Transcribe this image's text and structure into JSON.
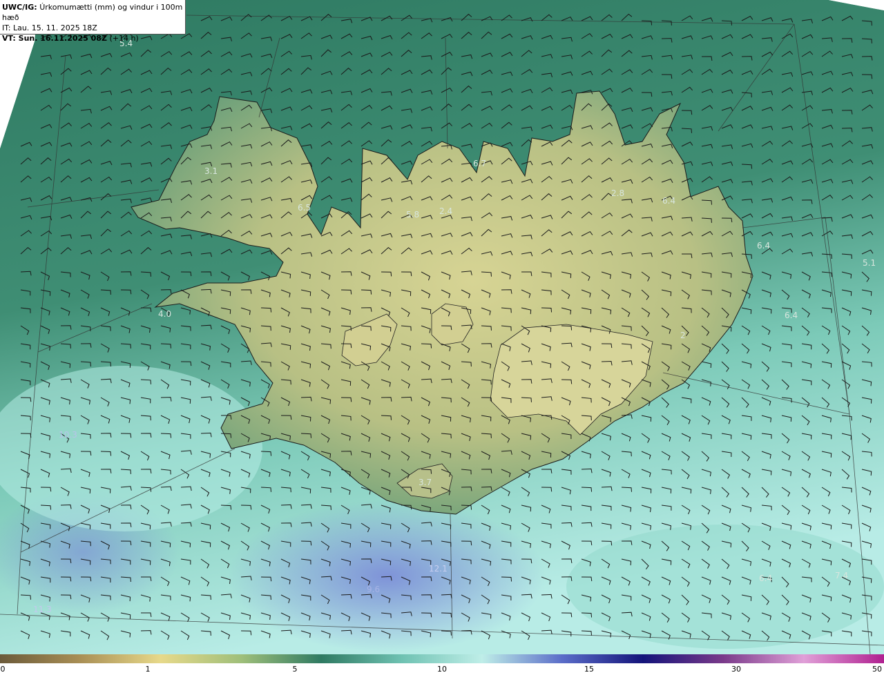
{
  "header": {
    "line1_bold": "UWC/IG:",
    "line1_text": "Úrkomumætti (mm) og vindur i 100m hæð",
    "line2": "IT: Lau. 15. 11. 2025 18Z",
    "line3_bold": "VT: Sun. 16.11.2025 08Z",
    "line3_text": "(+14 h)"
  },
  "map_labels": [
    {
      "text": "5.4"
    },
    {
      "text": "3.1"
    },
    {
      "text": "6.5"
    },
    {
      "text": "5.8"
    },
    {
      "text": "2.4"
    },
    {
      "text": "6.7"
    },
    {
      "text": "2.8"
    },
    {
      "text": "6.4"
    },
    {
      "text": "6.4"
    },
    {
      "text": "5.1"
    },
    {
      "text": "4.0"
    },
    {
      "text": "6.4"
    },
    {
      "text": "2"
    },
    {
      "text": "10.3"
    },
    {
      "text": "3.7"
    },
    {
      "text": "12.1"
    },
    {
      "text": "9.6"
    },
    {
      "text": "6.4"
    },
    {
      "text": "7.4"
    },
    {
      "text": "11.3"
    }
  ],
  "colorbar": {
    "ticks": [
      {
        "label": "0",
        "value": 0
      },
      {
        "label": "1",
        "value": 1
      },
      {
        "label": "5",
        "value": 5
      },
      {
        "label": "10",
        "value": 10
      },
      {
        "label": "15",
        "value": 15
      },
      {
        "label": "30",
        "value": 30
      },
      {
        "label": "50",
        "value": 50
      }
    ],
    "colors": [
      "#6b5a3a",
      "#a98f55",
      "#e7d98a",
      "#9fbf7a",
      "#2f7a62",
      "#6fc2b2",
      "#bfeee8",
      "#5a6cc8",
      "#14147a",
      "#7a3a8a",
      "#e0a0d8",
      "#b02090"
    ]
  },
  "colors": {
    "sea_dark": "#2f7a62",
    "sea_light": "#a7e4dc",
    "land": "#c9c98a",
    "heavy_rain": "#6b7dcf"
  }
}
